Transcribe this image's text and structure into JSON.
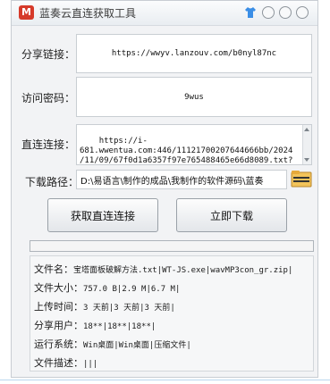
{
  "window": {
    "title": "蓝奏云直连获取工具",
    "controls": [
      "theme-icon",
      "minimize",
      "maximize",
      "close"
    ]
  },
  "share_link": {
    "label": "分享链接：",
    "value": "https://wwyv.lanzouv.com/b0nyl87nc"
  },
  "password": {
    "label": "访问密码：",
    "value": "9wus"
  },
  "direct_link": {
    "label": "直连连接：",
    "value": "https://i-\n681.wwentua.com:446/11121700207644666bb/2024\n/11/09/67f0d1a6357f97e765488465e66d8089.txt?"
  },
  "download_path": {
    "label": "下载路径：",
    "value": "D:\\易语言\\制作的成品\\我制作的软件源码\\蓝奏"
  },
  "buttons": {
    "get_link": "获取直连连接",
    "download": "立即下载"
  },
  "progress": {
    "percent": 0
  },
  "info": {
    "filename": {
      "k": "文件名：",
      "v": "宝塔面板破解方法.txt|WT-JS.exe|wavMP3con_gr.zip|"
    },
    "filesize": {
      "k": "文件大小：",
      "v": "757.0 B|2.9 M|6.7 M|"
    },
    "upload_time": {
      "k": "上传时间：",
      "v": "3 天前|3 天前|3 天前|"
    },
    "share_user": {
      "k": "分享用户：",
      "v": "18**|18**|18**|"
    },
    "os": {
      "k": "运行系统：",
      "v": "Win桌面|Win桌面|压缩文件|"
    },
    "desc": {
      "k": "文件描述：",
      "v": "|||"
    }
  }
}
